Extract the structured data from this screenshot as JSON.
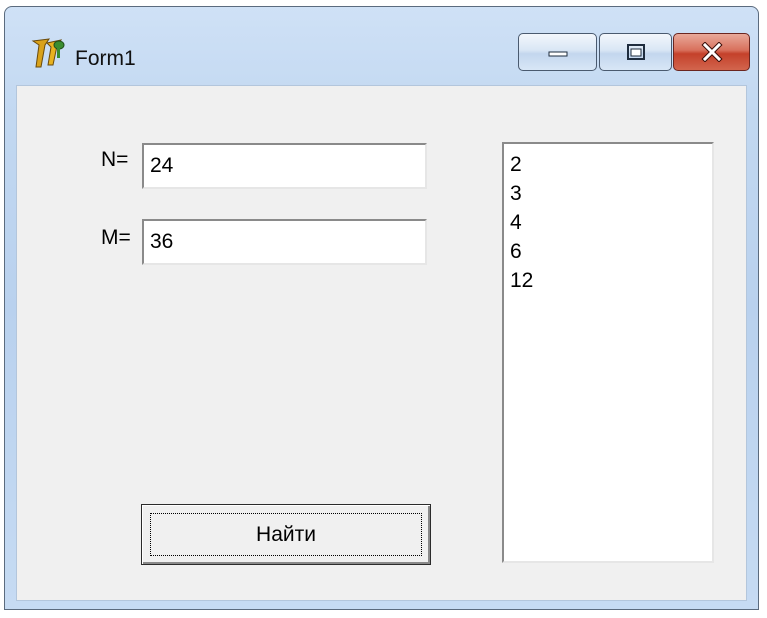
{
  "window": {
    "title": "Form1",
    "icon": "delphi-app-icon"
  },
  "controls": {
    "minimize": "minimize-icon",
    "maximize": "restore-icon",
    "close": "close-icon"
  },
  "form": {
    "n_label": "N=",
    "n_value": "24",
    "m_label": "M=",
    "m_value": "36",
    "button_label": "Найти"
  },
  "results": [
    "2",
    "3",
    "4",
    "6",
    "12"
  ]
}
